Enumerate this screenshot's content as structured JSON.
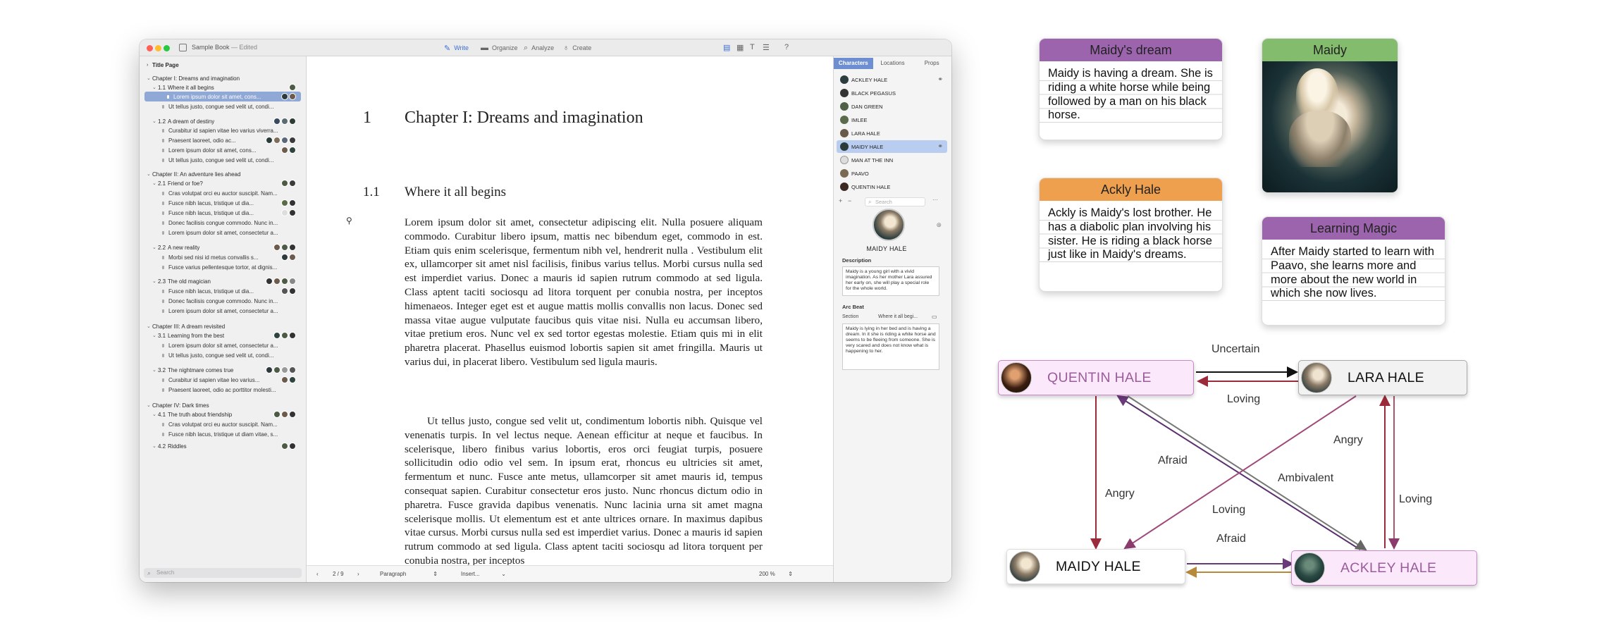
{
  "window": {
    "title": "Sample Book",
    "edited": "— Edited",
    "toolbar": [
      {
        "label": "Write",
        "active": true
      },
      {
        "label": "Organize",
        "active": false
      },
      {
        "label": "Analyze",
        "active": false
      },
      {
        "label": "Create",
        "active": false
      }
    ],
    "help": "?"
  },
  "binder": {
    "title_page": "Title Page",
    "chapters": [
      {
        "title": "Chapter I: Dreams and imagination",
        "sections": [
          {
            "num": "1.1",
            "title": "Where it all begins",
            "scenes": [
              "Lorem ipsum dolor sit amet, cons...",
              "Ut tellus justo, congue sed velit ut, condi..."
            ]
          },
          {
            "num": "1.2",
            "title": "A dream of destiny",
            "scenes": [
              "Curabitur id sapien vitae leo varius viverra...",
              "Praesent laoreet, odio ac...",
              "Lorem ipsum dolor sit amet, cons...",
              "Ut tellus justo, congue sed velit ut, condi..."
            ]
          }
        ]
      },
      {
        "title": "Chapter II: An adventure lies ahead",
        "sections": [
          {
            "num": "2.1",
            "title": "Friend or foe?",
            "scenes": [
              "Cras volutpat orci eu auctor suscipit. Nam...",
              "Fusce nibh lacus, tristique ut dia...",
              "Fusce nibh lacus, tristique ut dia...",
              "Donec facilisis congue commodo. Nunc in...",
              "Lorem ipsum dolor sit amet, consectetur a..."
            ]
          },
          {
            "num": "2.2",
            "title": "A new reality",
            "scenes": [
              "Morbi sed nisi id metus convallis s...",
              "Fusce varius pellentesque tortor, at dignis..."
            ]
          },
          {
            "num": "2.3",
            "title": "The old magician",
            "scenes": [
              "Fusce nibh lacus, tristique ut dia...",
              "Donec facilisis congue commodo. Nunc in...",
              "Lorem ipsum dolor sit amet, consectetur a..."
            ]
          }
        ]
      },
      {
        "title": "Chapter III: A dream revisited",
        "sections": [
          {
            "num": "3.1",
            "title": "Learning from the best",
            "scenes": [
              "Lorem ipsum dolor sit amet, consectetur a...",
              "Ut tellus justo, congue sed velit ut, condi..."
            ]
          },
          {
            "num": "3.2",
            "title": "The nightmare comes true",
            "scenes": [
              "Curabitur id sapien vitae leo varius...",
              "Praesent laoreet, odio ac porttitor molesti..."
            ]
          }
        ]
      },
      {
        "title": "Chapter IV: Dark times",
        "sections": [
          {
            "num": "4.1",
            "title": "The truth about friendship",
            "scenes": [
              "Cras volutpat orci eu auctor suscipit. Nam...",
              "Fusce nibh lacus, tristique ut diam vitae, s..."
            ]
          },
          {
            "num": "4.2",
            "title": "Riddles",
            "scenes": []
          }
        ]
      }
    ],
    "search_placeholder": "Search"
  },
  "editor": {
    "chapter_number": "1",
    "chapter_title": "Chapter I: Dreams and imagination",
    "section_number": "1.1",
    "section_title": "Where it all begins",
    "paragraph1": "Lorem ipsum dolor sit amet, consectetur adipiscing elit. Nulla posuere aliquam commodo. Curabitur libero ipsum, mattis nec bibendum eget, commodo in est. Etiam quis enim scelerisque, fermentum nibh vel, hendrerit nulla . Vestibulum elit ex, ullamcorper sit amet nisl facilisis, finibus varius tellus. Morbi cursus nulla sed est imperdiet varius. Donec a mauris id sapien rutrum commodo at sed ligula. Class aptent taciti sociosqu ad litora torquent per conubia nostra, per inceptos himenaeos. Integer eget est et augue mattis mollis convallis non lacus. Donec sed massa vitae augue vulputate faucibus quis vitae nisi. Nulla eu accumsan libero, vitae pretium eros. Nunc vel ex sed tortor egestas molestie. Etiam quis mi in elit pharetra placerat. Phasellus euismod lobortis sapien sit amet fringilla. Mauris ut varius dui, in placerat libero. Vestibulum sed ligula mauris.",
    "paragraph2": "Ut tellus justo, congue sed velit ut, condimentum lobortis nibh. Quisque vel venenatis turpis. In vel lectus neque. Aenean efficitur at neque et faucibus. In scelerisque, libero finibus varius lobortis, eros orci feugiat turpis, posuere sollicitudin odio odio vel sem. In ipsum erat, rhoncus eu ultricies sit amet, fermentum et nunc. Fusce ante metus, ullamcorper sit amet mauris id, tempus consequat sapien. Curabitur consectetur eros justo. Nunc rhoncus dictum odio in pharetra. Fusce gravida dapibus venenatis. Nunc lacinia urna sit amet magna scelerisque mollis. Ut elementum est et ante ultrices ornare. In maximus dapibus vitae cursus. Morbi cursus nulla sed est imperdiet varius. Donec a mauris id sapien rutrum commodo at sed ligula. Class aptent taciti sociosqu ad litora torquent per conubia nostra, per inceptos",
    "page_indicator": "2 / 9",
    "style_select": "Paragraph",
    "insert_select": "Insert...",
    "zoom": "200 %"
  },
  "inspector": {
    "tabs": [
      "Characters",
      "Locations",
      "Props"
    ],
    "characters": [
      "ACKLEY HALE",
      "BLACK PEGASUS",
      "DAN GREEN",
      "IMLEE",
      "LARA HALE",
      "MAIDY HALE",
      "MAN AT THE INN",
      "PAAVO",
      "QUENTIN HALE"
    ],
    "selected_character": "MAIDY HALE",
    "search_placeholder": "Search",
    "add": "+",
    "remove": "−",
    "more": "···",
    "description_label": "Description",
    "description": "Maidy is a young girl with a vivid imagination. As her mother Lara assured her early on, she will play a special role for the whole world.",
    "arc_label": "Arc Beat",
    "arc_section_label": "Section",
    "arc_section_value": "Where it all begi...",
    "arc_text": "Maidy is lying in her bed and is having a dream. In it she is riding a white horse and seems to be fleeing from someone. She is very scared and does not know what is happening to her."
  },
  "cards": {
    "dream": {
      "title": "Maidy's dream",
      "text": "Maidy is having a dream. She is riding a white horse while being followed by a man on his black horse.",
      "color": "#9c64ad"
    },
    "portrait": {
      "title": "Maidy",
      "color": "#82bc6c"
    },
    "ackly": {
      "title": "Ackly Hale",
      "text": "Ackly is Maidy's lost brother. He has a diabolic plan involving his sister. He is riding a black horse just like in Maidy's dreams.",
      "color": "#eea04e"
    },
    "magic": {
      "title": "Learning Magic",
      "text": "After Maidy started to learn with Paavo, she learns more and more about the new world in which she now lives.",
      "color": "#9c64ad"
    }
  },
  "graph": {
    "nodes": {
      "quentin": "QUENTIN HALE",
      "lara": "LARA HALE",
      "maidy": "MAIDY HALE",
      "ackley": "ACKLEY HALE"
    },
    "edges": {
      "uncertain": "Uncertain",
      "loving_top": "Loving",
      "angry_right": "Angry",
      "afraid_diag": "Afraid",
      "ambivalent": "Ambivalent",
      "angry_left": "Angry",
      "loving_mid": "Loving",
      "loving_right": "Loving",
      "afraid_bottom": "Afraid"
    }
  }
}
